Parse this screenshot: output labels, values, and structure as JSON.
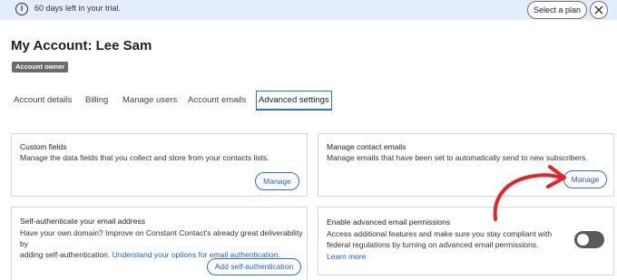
{
  "trial_banner": {
    "icon": "info-icon",
    "icon_glyph": "i",
    "message": "60 days left in your trial.",
    "select_plan_label": "Select a plan",
    "close_icon": "close-icon"
  },
  "header": {
    "title": "My Account: Lee Sam",
    "role_badge": "Account owner"
  },
  "tabs": [
    {
      "label": "Account details",
      "active": false
    },
    {
      "label": "Billing",
      "active": false
    },
    {
      "label": "Manage users",
      "active": false
    },
    {
      "label": "Account emails",
      "active": false
    },
    {
      "label": "Advanced settings",
      "active": true
    }
  ],
  "cards": {
    "custom_fields": {
      "title": "Custom fields",
      "description": "Manage the data fields that you collect and store from your contacts lists.",
      "button_label": "Manage"
    },
    "manage_contact_emails": {
      "title": "Manage contact emails",
      "description": "Manage emails that have been set to automatically send to new subscribers.",
      "button_label": "Manage"
    },
    "self_authenticate": {
      "title": "Self-authenticate your email address",
      "description_line1": "Have your own domain? Improve on Constant Contact's already great deliverability by",
      "description_line2_prefix": "adding self-authentication.",
      "link_text": "Understand your options for email authentication.",
      "button_label": "Add self-authentication"
    },
    "advanced_permissions": {
      "title": "Enable advanced email permissions",
      "description": "Access additional features and make sure you stay compliant with federal regulations by turning on advanced email permissions.",
      "link_text": "Learn more",
      "toggle_on": false
    }
  },
  "annotation": {
    "arrow_color": "#e8202a"
  },
  "colors": {
    "banner_bg": "#e4edfb",
    "accent": "#2e6fd6",
    "link": "#1d5fd1",
    "badge_bg": "#6b6b6b",
    "toggle_bg": "#5a5a5a"
  }
}
